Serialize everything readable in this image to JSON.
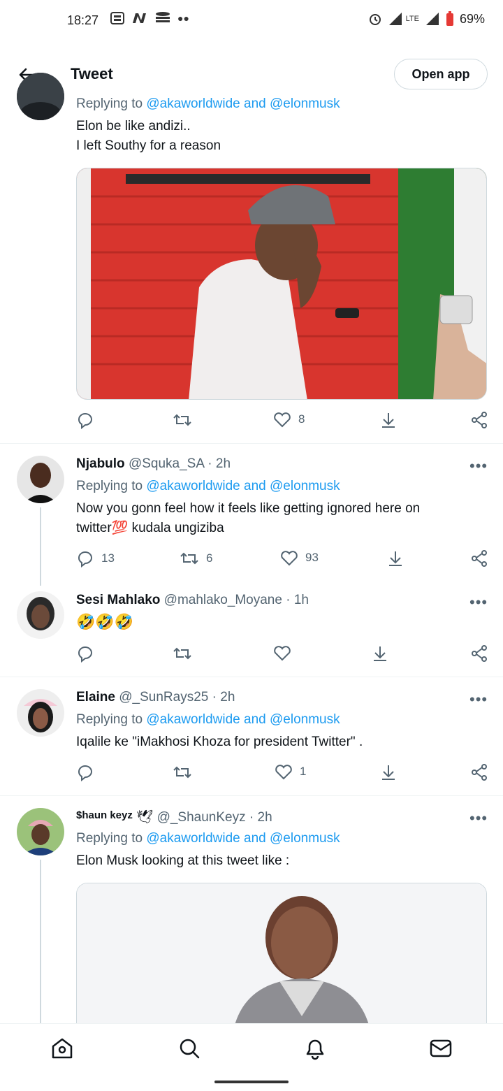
{
  "status": {
    "time": "18:27",
    "battery": "69%",
    "network": "LTE"
  },
  "header": {
    "title": "Tweet",
    "open_app": "Open app"
  },
  "tweets": [
    {
      "reply_to": "Replying to",
      "reply_users": "@akaworldwide and @elonmusk",
      "text_lines": [
        "Elon be like andizi..",
        "I left Southy for a reason"
      ],
      "likes": "8"
    },
    {
      "name": "Njabulo",
      "handle": "@Squka_SA",
      "time": "· 2h",
      "reply_to": "Replying to",
      "reply_users": "@akaworldwide and @elonmusk",
      "text_lines": [
        "Now you gonn feel how it feels like getting ignored here on",
        "twitter💯 kudala ungiziba"
      ],
      "replies": "13",
      "retweets": "6",
      "likes": "93"
    },
    {
      "name": "Sesi Mahlako",
      "handle": "@mahlako_Moyane",
      "time": "· 1h",
      "text_lines": [
        "🤣🤣🤣"
      ]
    },
    {
      "name": "Elaine",
      "handle": "@_SunRays25",
      "time": "· 2h",
      "reply_to": "Replying to",
      "reply_users": "@akaworldwide and @elonmusk",
      "text_lines": [
        "Iqalile ke \"iMakhosi Khoza for president Twitter\" ."
      ],
      "likes": "1"
    },
    {
      "name_img": "$haun keyz",
      "name_emoji": "🕊",
      "handle": "@_ShaunKeyz",
      "time": "· 2h",
      "reply_to": "Replying to",
      "reply_users": "@akaworldwide and @elonmusk",
      "text_lines": [
        "Elon Musk looking at this tweet like :"
      ]
    }
  ],
  "more": "•••",
  "colors": {
    "link": "#1d9bf0",
    "muted": "#536471",
    "accent": "#e0245e"
  }
}
